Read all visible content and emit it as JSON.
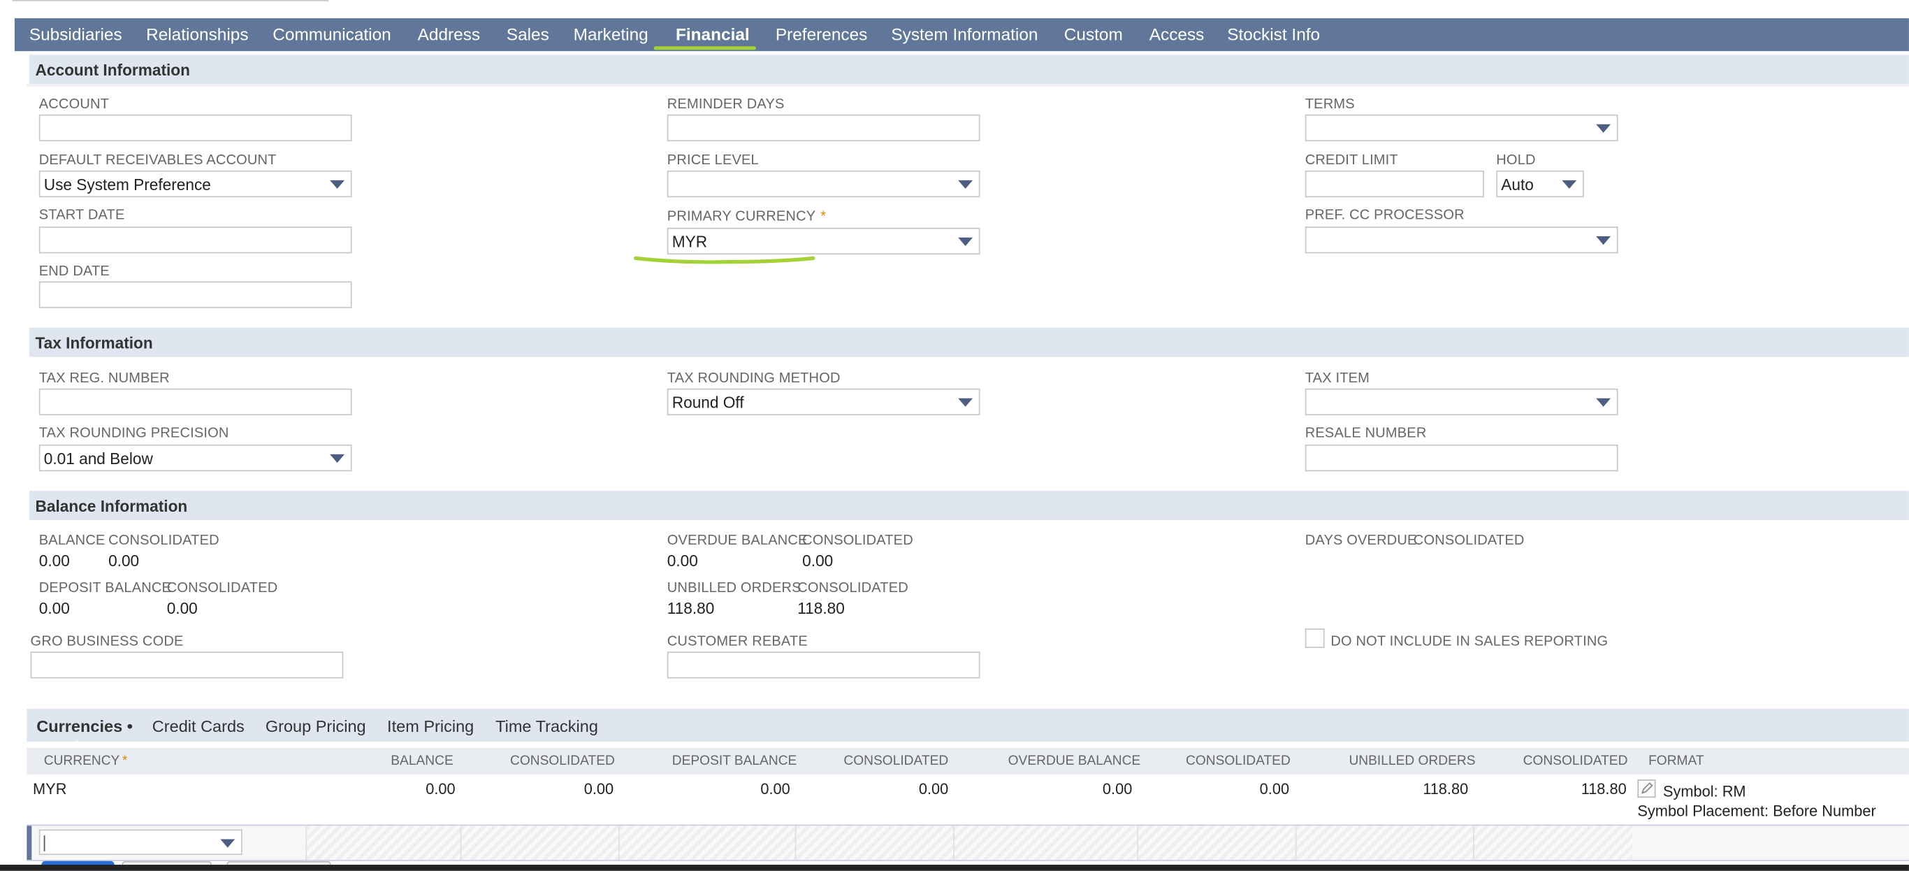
{
  "tabs": [
    "Subsidiaries",
    "Relationships",
    "Communication",
    "Address",
    "Sales",
    "Marketing",
    "Financial",
    "Preferences",
    "System Information",
    "Custom",
    "Access",
    "Stockist Info"
  ],
  "active_tab": "Financial",
  "account_info": {
    "title": "Account Information",
    "account_label": "ACCOUNT",
    "default_receivables_label": "DEFAULT RECEIVABLES ACCOUNT",
    "default_receivables_value": "Use System Preference",
    "start_date_label": "START DATE",
    "end_date_label": "END DATE",
    "reminder_days_label": "REMINDER DAYS",
    "price_level_label": "PRICE LEVEL",
    "primary_currency_label": "PRIMARY CURRENCY",
    "required_mark": "*",
    "primary_currency_value": "MYR",
    "terms_label": "TERMS",
    "credit_limit_label": "CREDIT LIMIT",
    "hold_label": "HOLD",
    "hold_value": "Auto",
    "pref_cc_label": "PREF. CC PROCESSOR"
  },
  "tax_info": {
    "title": "Tax Information",
    "tax_reg_label": "TAX REG. NUMBER",
    "rounding_precision_label": "TAX ROUNDING PRECISION",
    "rounding_precision_value": "0.01 and Below",
    "rounding_method_label": "TAX ROUNDING METHOD",
    "rounding_method_value": "Round Off",
    "tax_item_label": "TAX ITEM",
    "resale_label": "RESALE NUMBER"
  },
  "balance_info": {
    "title": "Balance Information",
    "balance_label": "BALANCE",
    "balance_value": "0.00",
    "consolidated_label": "CONSOLIDATED",
    "balance_consolidated": "0.00",
    "deposit_label": "DEPOSIT BALANCE",
    "deposit_value": "0.00",
    "deposit_consolidated": "0.00",
    "overdue_label": "OVERDUE BALANCE",
    "overdue_value": "0.00",
    "overdue_consolidated": "0.00",
    "unbilled_label": "UNBILLED ORDERS",
    "unbilled_value": "118.80",
    "unbilled_consolidated": "118.80",
    "days_overdue_label": "DAYS OVERDUE",
    "gro_label": "GRO BUSINESS CODE",
    "rebate_label": "CUSTOMER REBATE",
    "dni_label": "DO NOT INCLUDE IN SALES REPORTING"
  },
  "subtabs": [
    "Currencies •",
    "Credit Cards",
    "Group Pricing",
    "Item Pricing",
    "Time Tracking"
  ],
  "table": {
    "headers": [
      "CURRENCY",
      "BALANCE",
      "CONSOLIDATED",
      "DEPOSIT BALANCE",
      "CONSOLIDATED",
      "OVERDUE BALANCE",
      "CONSOLIDATED",
      "UNBILLED ORDERS",
      "CONSOLIDATED",
      "FORMAT"
    ],
    "currency_required": "*",
    "row": [
      "MYR",
      "0.00",
      "0.00",
      "0.00",
      "0.00",
      "0.00",
      "0.00",
      "118.80",
      "118.80"
    ],
    "format_line1": "Symbol: RM",
    "format_line2": "Symbol Placement: Before Number"
  },
  "colors": {
    "tab_bar": "#607799",
    "annotation": "#a4d135",
    "section": "#e0e6ef"
  }
}
